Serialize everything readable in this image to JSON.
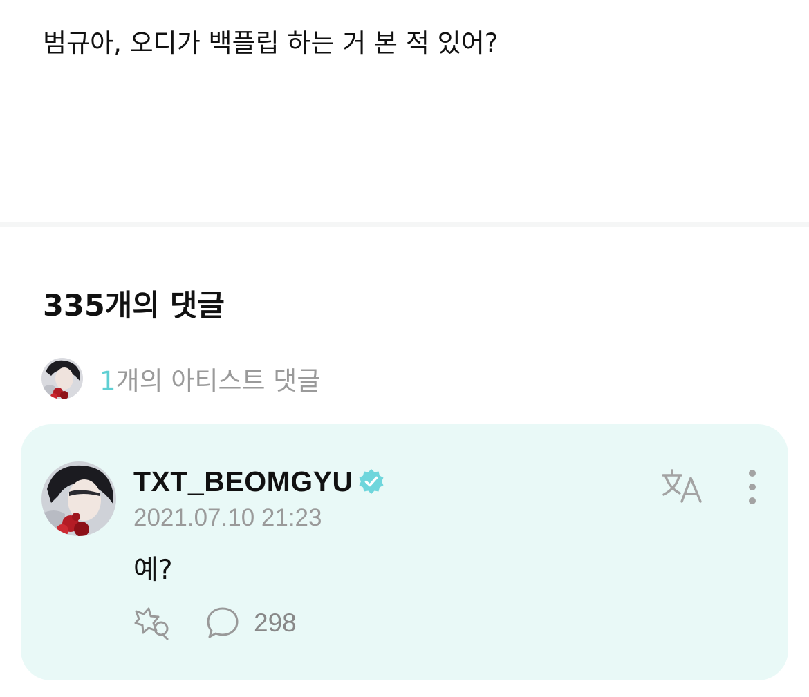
{
  "post": {
    "text": "범규아, 오디가 백플립 하는 거 본 적 있어?"
  },
  "comments_header": {
    "title": "335개의 댓글"
  },
  "artist_summary": {
    "count": "1",
    "label": "개의 아티스트 댓글"
  },
  "comment": {
    "author": "TXT_BEOMGYU",
    "timestamp": "2021.07.10 21:23",
    "body": "예?",
    "reply_count": "298"
  },
  "icons": {
    "verified": "verified-badge-icon",
    "translate": "translate-icon",
    "more": "more-vertical-icon",
    "react": "reaction-icon",
    "reply": "speech-bubble-icon"
  },
  "colors": {
    "accent": "#5fcfd3",
    "card_bg": "#e9f9f7",
    "muted_text": "#9a9a9a"
  }
}
